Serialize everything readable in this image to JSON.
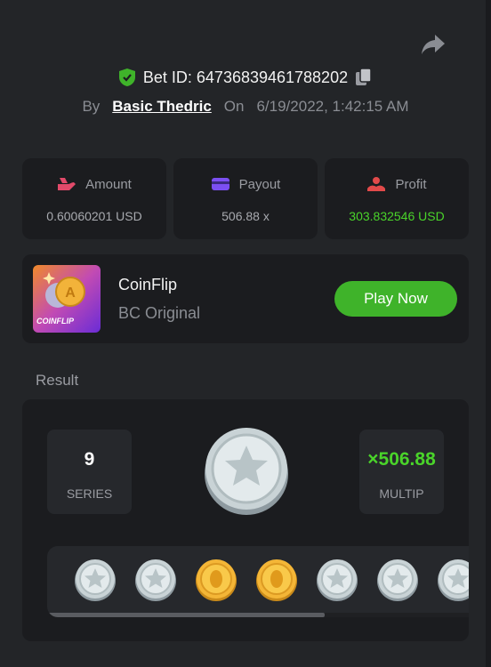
{
  "header": {
    "bet_label": "Bet ID: 64736839461788202",
    "by_label": "By",
    "username": "Basic Thedric",
    "on_label": "On",
    "datetime": "6/19/2022, 1:42:15 AM"
  },
  "stats": [
    {
      "label": "Amount",
      "value": "0.60060201 USD",
      "icon": "amount-icon"
    },
    {
      "label": "Payout",
      "value": "506.88 x",
      "icon": "card-icon"
    },
    {
      "label": "Profit",
      "value": "303.832546 USD",
      "icon": "profit-icon",
      "value_color": "#4ad42a"
    }
  ],
  "game": {
    "name": "CoinFlip",
    "subtitle": "BC Original",
    "thumb_text": "COINFLIP",
    "play_label": "Play Now"
  },
  "result": {
    "title": "Result",
    "series_value": "9",
    "series_label": "SERIES",
    "multiplier_value": "×506.88",
    "multiplier_label": "MULTIP",
    "main_coin": "silver-star",
    "coins": [
      "silver-star",
      "silver-star",
      "gold-a",
      "gold-a",
      "silver-star",
      "silver-star",
      "silver-star"
    ]
  },
  "colors": {
    "background": "#232528",
    "card": "#1b1c1f",
    "accent_green": "#3fb32a",
    "profit_green": "#4ad42a"
  }
}
